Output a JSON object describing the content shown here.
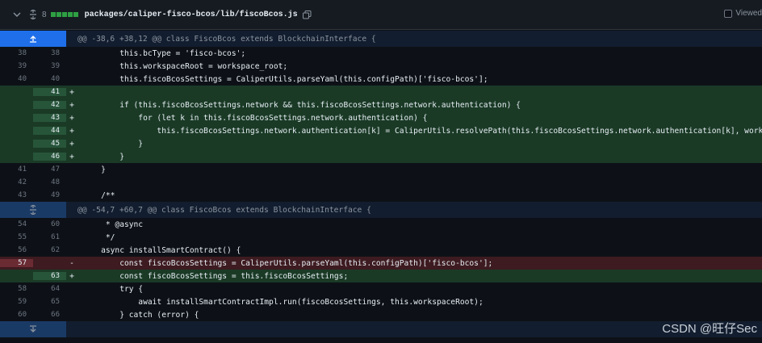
{
  "file_header": {
    "changes_count": "8",
    "path": "packages/caliper-fisco-bcos/lib/fiscoBcos.js",
    "viewed_label": "Viewed",
    "icons": [
      "chevron-down-icon",
      "unfold-icon",
      "copy-icon"
    ]
  },
  "hunks": [
    {
      "header": "@@ -38,6 +38,12 @@ class FiscoBcos extends BlockchainInterface {"
    },
    {
      "header": "@@ -54,7 +60,7 @@ class FiscoBcos extends BlockchainInterface {"
    }
  ],
  "lines": [
    {
      "type": "ctx",
      "old": "38",
      "new": "38",
      "marker": "",
      "code": "        this.bcType = 'fisco-bcos';"
    },
    {
      "type": "ctx",
      "old": "39",
      "new": "39",
      "marker": "",
      "code": "        this.workspaceRoot = workspace_root;"
    },
    {
      "type": "ctx",
      "old": "40",
      "new": "40",
      "marker": "",
      "code": "        this.fiscoBcosSettings = CaliperUtils.parseYaml(this.configPath)['fisco-bcos'];"
    },
    {
      "type": "add",
      "old": "",
      "new": "41",
      "marker": "+",
      "code": ""
    },
    {
      "type": "add",
      "old": "",
      "new": "42",
      "marker": "+",
      "code": "        if (this.fiscoBcosSettings.network && this.fiscoBcosSettings.network.authentication) {"
    },
    {
      "type": "add",
      "old": "",
      "new": "43",
      "marker": "+",
      "code": "            for (let k in this.fiscoBcosSettings.network.authentication) {"
    },
    {
      "type": "add",
      "old": "",
      "new": "44",
      "marker": "+",
      "code": "                this.fiscoBcosSettings.network.authentication[k] = CaliperUtils.resolvePath(this.fiscoBcosSettings.network.authentication[k], workspace_root);"
    },
    {
      "type": "add",
      "old": "",
      "new": "45",
      "marker": "+",
      "code": "            }"
    },
    {
      "type": "add",
      "old": "",
      "new": "46",
      "marker": "+",
      "code": "        }"
    },
    {
      "type": "ctx",
      "old": "41",
      "new": "47",
      "marker": "",
      "code": "    }"
    },
    {
      "type": "ctx",
      "old": "42",
      "new": "48",
      "marker": "",
      "code": ""
    },
    {
      "type": "ctx",
      "old": "43",
      "new": "49",
      "marker": "",
      "code": "    /**"
    },
    {
      "type": "ctx",
      "old": "54",
      "new": "60",
      "marker": "",
      "code": "     * @async"
    },
    {
      "type": "ctx",
      "old": "55",
      "new": "61",
      "marker": "",
      "code": "     */"
    },
    {
      "type": "ctx",
      "old": "56",
      "new": "62",
      "marker": "",
      "code": "    async installSmartContract() {"
    },
    {
      "type": "del",
      "old": "57",
      "new": "",
      "marker": "-",
      "code": "        const fiscoBcosSettings = CaliperUtils.parseYaml(this.configPath)['fisco-bcos'];"
    },
    {
      "type": "add",
      "old": "",
      "new": "63",
      "marker": "+",
      "code": "        const fiscoBcosSettings = this.fiscoBcosSettings;"
    },
    {
      "type": "ctx",
      "old": "58",
      "new": "64",
      "marker": "",
      "code": "        try {"
    },
    {
      "type": "ctx",
      "old": "59",
      "new": "65",
      "marker": "",
      "code": "            await installSmartContractImpl.run(fiscoBcosSettings, this.workspaceRoot);"
    },
    {
      "type": "ctx",
      "old": "60",
      "new": "66",
      "marker": "",
      "code": "        } catch (error) {"
    }
  ],
  "watermark": "CSDN @旺仔Sec",
  "colors": {
    "add_bg": "#1a3a26",
    "del_bg": "#3d1b20",
    "hunk_expand": "#1f6feb",
    "accent_green": "#2ea043"
  }
}
